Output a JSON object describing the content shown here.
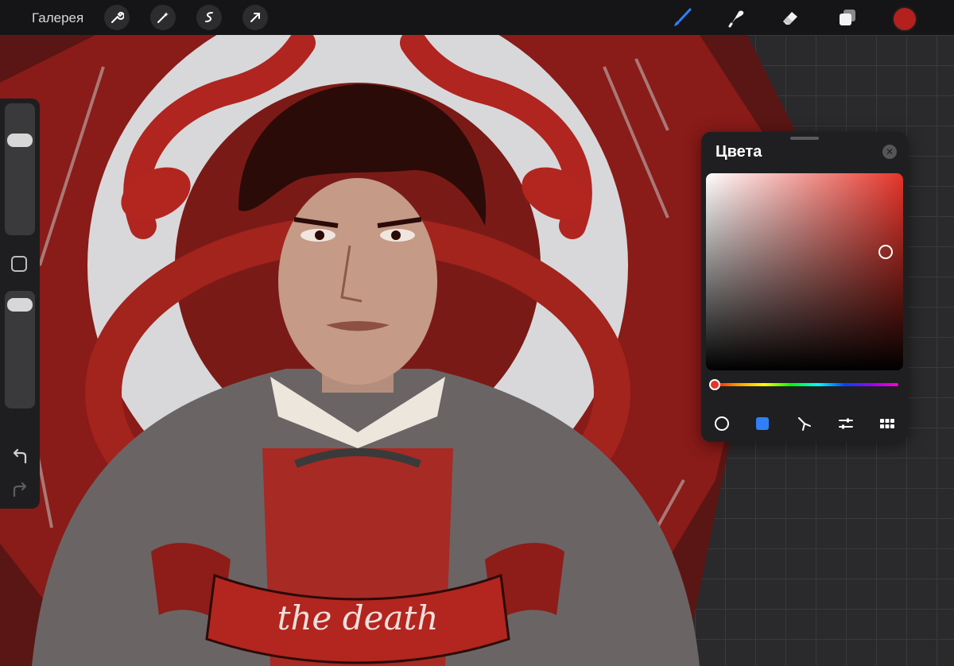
{
  "toolbar": {
    "gallery_label": "Галерея",
    "left_icons": [
      "wrench-icon",
      "magic-wand-icon",
      "selection-icon",
      "transform-arrow-icon"
    ],
    "right_icons": [
      "brush-icon",
      "smudge-icon",
      "eraser-icon",
      "layers-icon"
    ],
    "active_tool": "brush-icon",
    "current_color": "#b3201e",
    "accent_color": "#2f7ff7"
  },
  "sidebar": {
    "brush_size": 0.76,
    "opacity": 0.96,
    "icons": [
      "modify-square-icon",
      "undo-icon",
      "redo-icon"
    ]
  },
  "colors_panel": {
    "title": "Цвета",
    "saturation": 0.91,
    "brightness": 0.6,
    "hue": 0.02,
    "tabs": [
      "disc-tab-icon",
      "classic-tab-icon",
      "harmony-tab-icon",
      "value-tab-icon",
      "palettes-tab-icon"
    ],
    "active_tab": "classic-tab-icon"
  },
  "artwork": {
    "banner_text": "the death"
  }
}
